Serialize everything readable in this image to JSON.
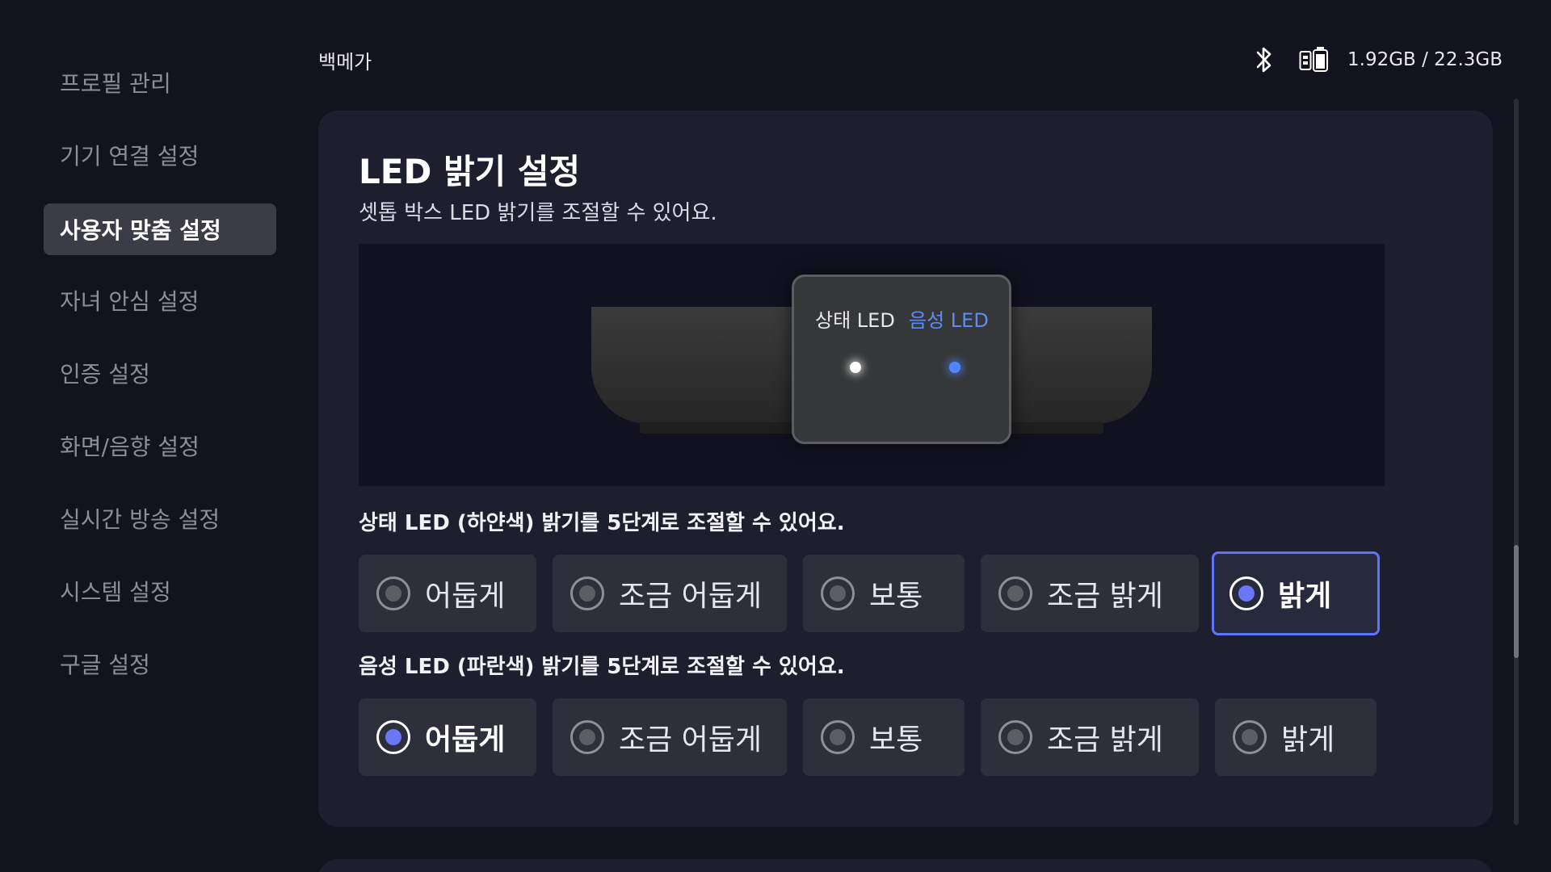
{
  "sidebar": {
    "items": [
      {
        "label": "프로필 관리"
      },
      {
        "label": "기기 연결 설정"
      },
      {
        "label": "사용자 맞춤 설정"
      },
      {
        "label": "자녀 안심 설정"
      },
      {
        "label": "인증 설정"
      },
      {
        "label": "화면/음향 설정"
      },
      {
        "label": "실시간 방송 설정"
      },
      {
        "label": "시스템 설정"
      },
      {
        "label": "구글 설정"
      }
    ],
    "active_index": 2
  },
  "header": {
    "user_name": "백메가",
    "storage": "1.92GB / 22.3GB",
    "icons": [
      "bluetooth-icon",
      "battery-icon"
    ]
  },
  "panel": {
    "title": "LED 밝기 설정",
    "subtitle": "셋톱 박스 LED 밝기를 조절할 수 있어요.",
    "preview": {
      "status_led_label": "상태 LED",
      "voice_led_label": "음성 LED"
    },
    "status_led": {
      "label": "상태 LED (하얀색) 밝기를 5단계로 조절할 수 있어요.",
      "options": [
        "어둡게",
        "조금 어둡게",
        "보통",
        "조금 밝게",
        "밝게"
      ],
      "selected": "밝게"
    },
    "voice_led": {
      "label": "음성 LED (파란색) 밝기를 5단계로 조절할 수 있어요.",
      "options": [
        "어둡게",
        "조금 어둡게",
        "보통",
        "조금 밝게",
        "밝게"
      ],
      "selected": "어둡게"
    }
  },
  "colors": {
    "background": "#13121f",
    "panel": "#1d1f2e",
    "accent": "#5f73f6",
    "voice_led": "#4f86ff"
  }
}
